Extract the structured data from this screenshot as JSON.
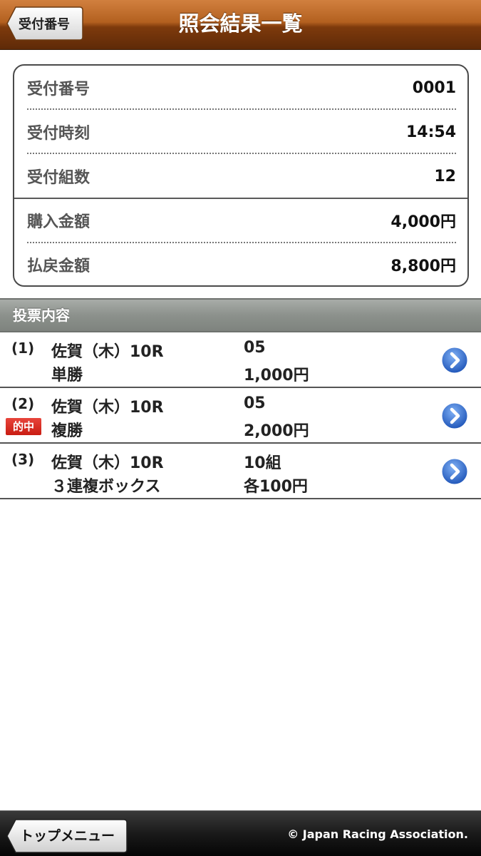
{
  "header": {
    "title": "照会結果一覧",
    "back_label": "受付番号"
  },
  "summary": {
    "rows": [
      {
        "label": "受付番号",
        "value": "0001"
      },
      {
        "label": "受付時刻",
        "value": "14:54"
      },
      {
        "label": "受付組数",
        "value": "12"
      },
      {
        "label": "購入金額",
        "value": "4,000円"
      },
      {
        "label": "払戻金額",
        "value": "8,800円"
      }
    ]
  },
  "section": {
    "title": "投票内容"
  },
  "bets": [
    {
      "num": "(1)",
      "race": "佐賀（木）10R",
      "kind": "単勝",
      "combo": "05",
      "amount": "1,000円",
      "hit": ""
    },
    {
      "num": "(2)",
      "race": "佐賀（木）10R",
      "kind": "複勝",
      "combo": "05",
      "amount": "2,000円",
      "hit": "的中"
    },
    {
      "num": "(3)",
      "race": "佐賀（木）10R",
      "kind": "３連複ボックス",
      "combo": "10組",
      "amount": "各100円",
      "hit": ""
    }
  ],
  "footer": {
    "top_menu_label": "トップメニュー",
    "copyright": "© Japan Racing Association."
  },
  "colors": {
    "header_brown": "#8a4513",
    "hit_red": "#d9261c",
    "arrow_blue": "#2f67c9"
  }
}
